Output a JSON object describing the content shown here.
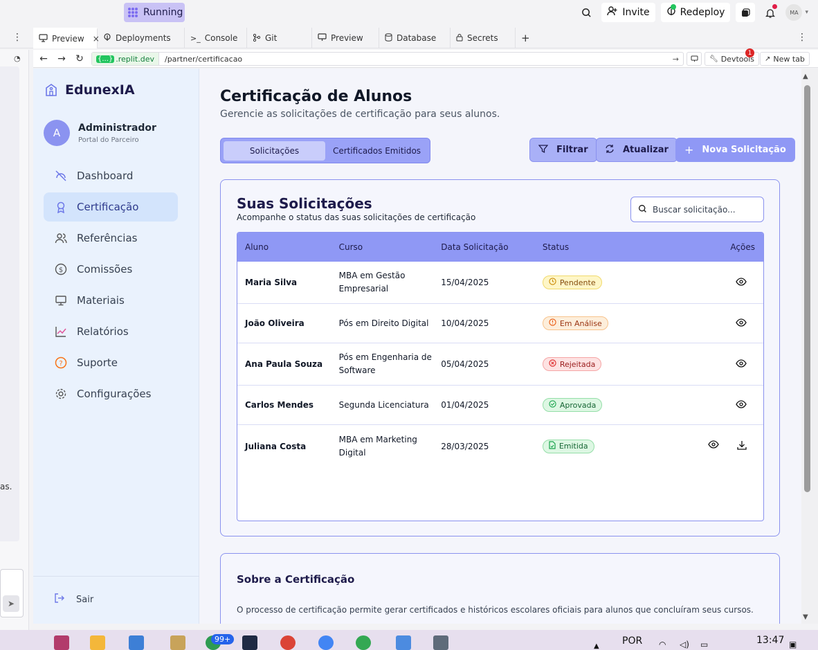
{
  "ide": {
    "run_label": "Running",
    "invite_label": "Invite",
    "redeploy_label": "Redeploy",
    "avatar_initials": "MA",
    "tabs": [
      {
        "label": "Preview"
      },
      {
        "label": "Deployments"
      },
      {
        "label": "Console"
      },
      {
        "label": "Git"
      },
      {
        "label": "Preview"
      },
      {
        "label": "Database"
      },
      {
        "label": "Secrets"
      }
    ],
    "url_host": ".replit.dev",
    "url_braces": "{...}",
    "url_path": "/partner/certificacao",
    "devtools_label": "Devtools",
    "devtools_badge": "1",
    "newtab_label": "New tab",
    "left_fragment": "as."
  },
  "app": {
    "brand": "EdunexIA",
    "user": {
      "initial": "A",
      "name": "Administrador",
      "role": "Portal do Parceiro"
    },
    "nav": [
      {
        "label": "Dashboard",
        "icon": "dashboard-icon",
        "active": false
      },
      {
        "label": "Certificação",
        "icon": "award-icon",
        "active": true
      },
      {
        "label": "Referências",
        "icon": "users-icon",
        "active": false
      },
      {
        "label": "Comissões",
        "icon": "dollar-icon",
        "active": false
      },
      {
        "label": "Materiais",
        "icon": "monitor-icon",
        "active": false
      },
      {
        "label": "Relatórios",
        "icon": "chart-line-icon",
        "active": false
      },
      {
        "label": "Suporte",
        "icon": "help-icon",
        "active": false
      },
      {
        "label": "Configurações",
        "icon": "gear-icon",
        "active": false
      }
    ],
    "logout_label": "Sair",
    "page_title": "Certificação de Alunos",
    "page_subtitle": "Gerencie as solicitações de certificação para seus alunos.",
    "segment": {
      "active": "Solicitações",
      "inactive": "Certificados Emitidos"
    },
    "buttons": {
      "filter": "Filtrar",
      "refresh": "Atualizar",
      "new": "Nova Solicitação"
    },
    "requests_card": {
      "title": "Suas Solicitações",
      "subtitle": "Acompanhe o status das suas solicitações de certificação",
      "search_placeholder": "Buscar solicitação...",
      "columns": [
        "Aluno",
        "Curso",
        "Data Solicitação",
        "Status",
        "Ações"
      ],
      "rows": [
        {
          "aluno": "Maria Silva",
          "curso_l1": "MBA em Gestão",
          "curso_l2": "Empresarial",
          "data": "15/04/2025",
          "status": "Pendente",
          "kind": "pend",
          "download": false
        },
        {
          "aluno": "João Oliveira",
          "curso_l1": "Pós em Direito Digital",
          "curso_l2": "",
          "data": "10/04/2025",
          "status": "Em Análise",
          "kind": "anal",
          "download": false
        },
        {
          "aluno": "Ana Paula Souza",
          "curso_l1": "Pós em Engenharia de",
          "curso_l2": "Software",
          "data": "05/04/2025",
          "status": "Rejeitada",
          "kind": "rej",
          "download": false
        },
        {
          "aluno": "Carlos Mendes",
          "curso_l1": "Segunda Licenciatura",
          "curso_l2": "",
          "data": "01/04/2025",
          "status": "Aprovada",
          "kind": "apr",
          "download": false
        },
        {
          "aluno": "Juliana Costa",
          "curso_l1": "MBA em Marketing",
          "curso_l2": "Digital",
          "data": "28/03/2025",
          "status": "Emitida",
          "kind": "emi",
          "download": true
        }
      ]
    },
    "about_card": {
      "title": "Sobre a Certificação",
      "text": "O processo de certificação permite gerar certificados e históricos escolares oficiais para alunos que concluíram seus cursos."
    }
  },
  "taskbar": {
    "lang": "POR",
    "time": "13:47",
    "badge_count": "99+"
  }
}
